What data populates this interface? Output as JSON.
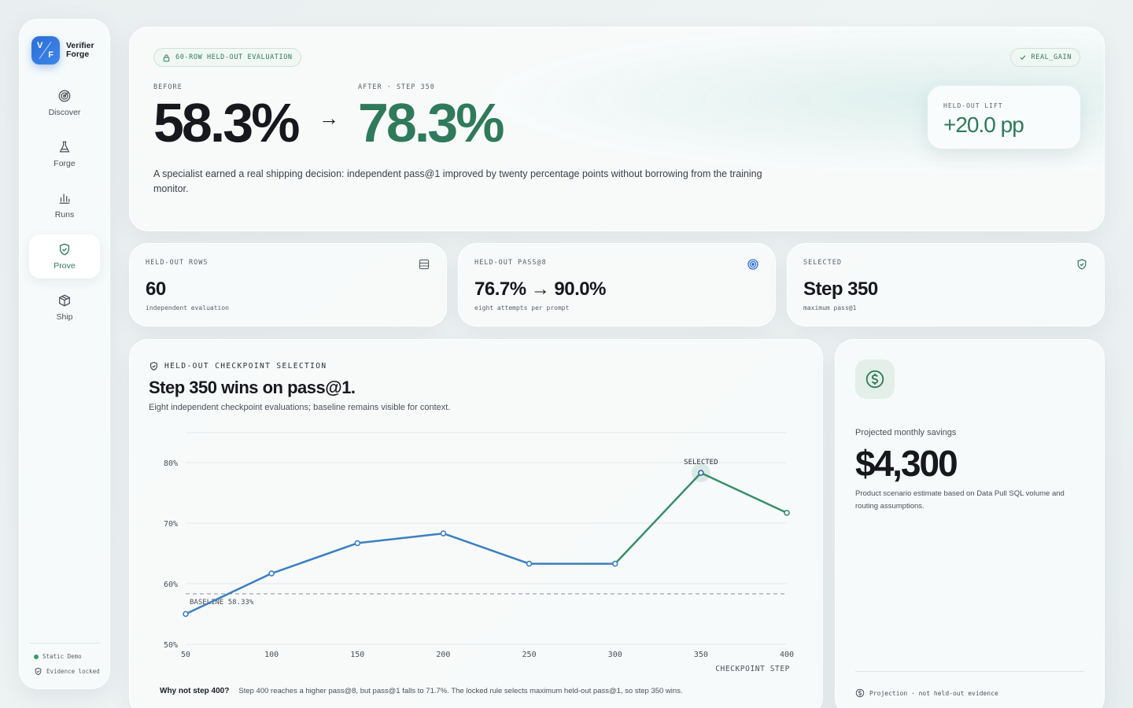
{
  "brand": {
    "mark_v": "V",
    "mark_f": "F",
    "name_line1": "Verifier",
    "name_line2": "Forge"
  },
  "nav": [
    {
      "label": "Discover",
      "icon": "target-icon"
    },
    {
      "label": "Forge",
      "icon": "flask-icon"
    },
    {
      "label": "Runs",
      "icon": "bar-chart-icon"
    },
    {
      "label": "Prove",
      "icon": "shield-icon",
      "active": true
    },
    {
      "label": "Ship",
      "icon": "box-icon"
    }
  ],
  "sidebar_footer": {
    "status": "Static Demo",
    "evidence": "Evidence locked"
  },
  "hero": {
    "pill": "60-ROW HELD-OUT EVALUATION",
    "badge": "REAL_GAIN",
    "before_label": "BEFORE",
    "before_value": "58.3%",
    "arrow": "→",
    "after_label": "AFTER · STEP 350",
    "after_value": "78.3%",
    "description": "A specialist earned a real shipping decision: independent pass@1 improved by twenty percentage points without borrowing from the training monitor.",
    "lift_label": "HELD-OUT LIFT",
    "lift_value": "+20.0 pp"
  },
  "stats": [
    {
      "label": "HELD-OUT ROWS",
      "value": "60",
      "sub": "independent evaluation",
      "icon": "table-icon"
    },
    {
      "label": "HELD-OUT PASS@8",
      "value": "76.7% → 90.0%",
      "sub": "eight attempts per prompt",
      "icon": "target-icon"
    },
    {
      "label": "SELECTED",
      "value": "Step 350",
      "sub": "maximum pass@1",
      "icon": "shield-check-icon"
    }
  ],
  "checkpoint": {
    "header": "HELD-OUT CHECKPOINT SELECTION",
    "title": "Step 350 wins on pass@1.",
    "description": "Eight independent checkpoint evaluations; baseline remains visible for context.",
    "why_title": "Why not step 400?",
    "why_text": "Step 400 reaches a higher pass@8, but pass@1 falls to 71.7%. The locked rule selects maximum held-out pass@1, so step 350 wins."
  },
  "chart_data": {
    "type": "line",
    "x": [
      50,
      100,
      150,
      200,
      250,
      300,
      350,
      400
    ],
    "series": [
      {
        "values": [
          55.0,
          61.7,
          66.7,
          68.3,
          63.3,
          63.3,
          78.3,
          71.7
        ]
      }
    ],
    "xlabel": "CHECKPOINT STEP",
    "ylabel": "",
    "xlim": [
      50,
      400
    ],
    "ylim": [
      50,
      80
    ],
    "xticks": [
      50,
      100,
      150,
      200,
      250,
      300,
      350,
      400
    ],
    "yticks": [
      {
        "v": 50,
        "label": "50%"
      },
      {
        "v": 60,
        "label": "60%"
      },
      {
        "v": 70,
        "label": "70%"
      },
      {
        "v": 80,
        "label": "80%"
      }
    ],
    "baseline": {
      "value": 58.33,
      "label": "BASELINE 58.33%"
    },
    "selected": {
      "x": 350,
      "label": "SELECTED"
    },
    "colors": {
      "before_selected": "#3b7fc0",
      "after_selected": "#3a8f6a",
      "baseline": "#8a9096"
    },
    "grid": true
  },
  "savings": {
    "label": "Projected monthly savings",
    "value": "$4,300",
    "description": "Product scenario estimate based on Data Pull SQL volume and routing assumptions.",
    "footer": "Projection · not held-out evidence"
  },
  "colors": {
    "accent_green": "#2f7a5a",
    "accent_blue": "#2d6fd6"
  }
}
